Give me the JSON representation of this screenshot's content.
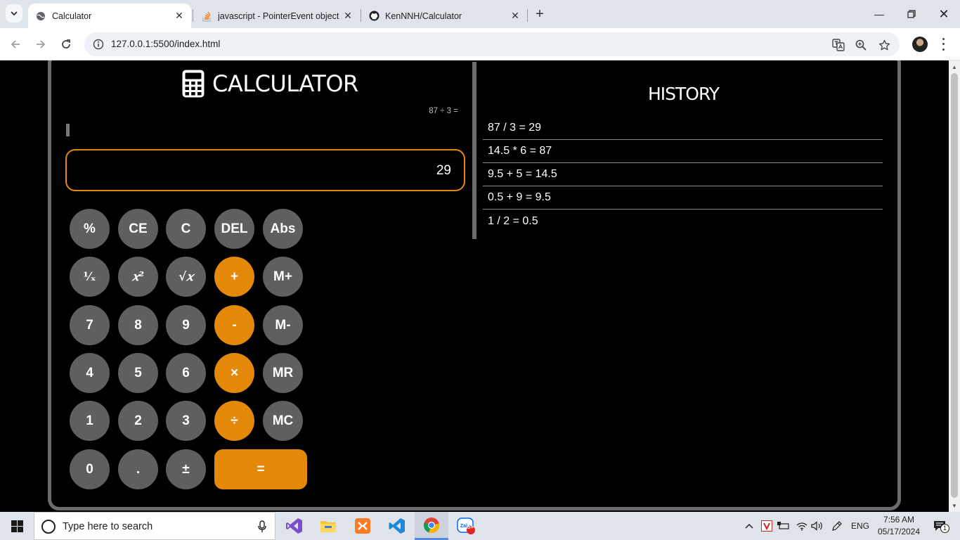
{
  "browser": {
    "tabs": [
      {
        "title": "Calculator",
        "active": true
      },
      {
        "title": "javascript - PointerEvent object",
        "active": false
      },
      {
        "title": "KenNNH/Calculator",
        "active": false
      }
    ],
    "url": "127.0.0.1:5500/index.html"
  },
  "calculator": {
    "title": "CALCULATOR",
    "expression": "87 ÷ 3 =",
    "display_value": "29",
    "buttons": {
      "row1": [
        "%",
        "CE",
        "C",
        "DEL",
        "Abs"
      ],
      "row2": [
        "¹⁄ₓ",
        "𝑥²",
        "√𝑥",
        "+",
        "M+"
      ],
      "row3": [
        "7",
        "8",
        "9",
        "-",
        "M-"
      ],
      "row4": [
        "4",
        "5",
        "6",
        "×",
        "MR"
      ],
      "row5": [
        "1",
        "2",
        "3",
        "÷",
        "MC"
      ],
      "row6": [
        "0",
        ".",
        "±",
        "="
      ]
    },
    "colors": {
      "accent": "#e5890b",
      "button": "#5f5f5f",
      "frame": "#6b6b6b"
    }
  },
  "history": {
    "title": "HISTORY",
    "items": [
      "87 / 3 = 29",
      "14.5 * 6 = 87",
      "9.5 + 5 = 14.5",
      "0.5 + 9 = 9.5",
      "1 / 2 = 0.5"
    ]
  },
  "taskbar": {
    "search_placeholder": "Type here to search",
    "language": "ENG",
    "time": "7:56 AM",
    "date": "05/17/2024",
    "notification_count": "1",
    "zalo_badge": "5+"
  }
}
